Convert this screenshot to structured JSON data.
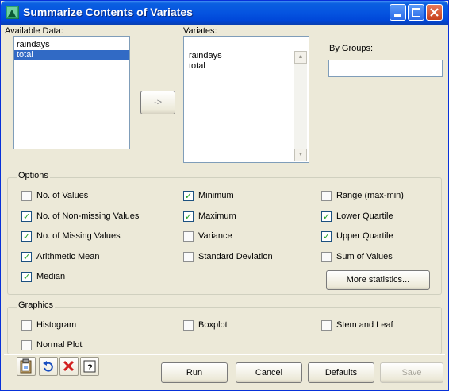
{
  "window": {
    "title": "Summarize Contents of Variates"
  },
  "available_data": {
    "label": "Available Data:",
    "items": [
      "raindays",
      "total"
    ],
    "selected_index": 1
  },
  "transfer_button": {
    "label": "->"
  },
  "variates": {
    "label": "Variates:",
    "items": [
      "raindays",
      "total"
    ]
  },
  "by_groups": {
    "label": "By Groups:",
    "value": ""
  },
  "options": {
    "title": "Options",
    "checkboxes": [
      {
        "label": "No. of Values",
        "checked": false
      },
      {
        "label": "No. of Non-missing Values",
        "checked": true
      },
      {
        "label": "No. of Missing Values",
        "checked": true
      },
      {
        "label": "Arithmetic Mean",
        "checked": true
      },
      {
        "label": "Median",
        "checked": true
      },
      {
        "label": "Minimum",
        "checked": true
      },
      {
        "label": "Maximum",
        "checked": true
      },
      {
        "label": "Variance",
        "checked": false
      },
      {
        "label": "Standard Deviation",
        "checked": false
      },
      {
        "label": "Range (max-min)",
        "checked": false
      },
      {
        "label": "Lower Quartile",
        "checked": true
      },
      {
        "label": "Upper Quartile",
        "checked": true
      },
      {
        "label": "Sum of Values",
        "checked": false
      }
    ],
    "more_button": "More statistics..."
  },
  "graphics": {
    "title": "Graphics",
    "checkboxes": [
      {
        "label": "Histogram",
        "checked": false
      },
      {
        "label": "Normal Plot",
        "checked": false
      },
      {
        "label": "Boxplot",
        "checked": false
      },
      {
        "label": "Stem and Leaf",
        "checked": false
      }
    ]
  },
  "footer": {
    "run": "Run",
    "cancel": "Cancel",
    "defaults": "Defaults",
    "save": "Save"
  },
  "colors": {
    "titlebar": "#0554e0",
    "selection": "#316ac5",
    "dialog_bg": "#ece9d8",
    "check_mark": "#21a121"
  }
}
